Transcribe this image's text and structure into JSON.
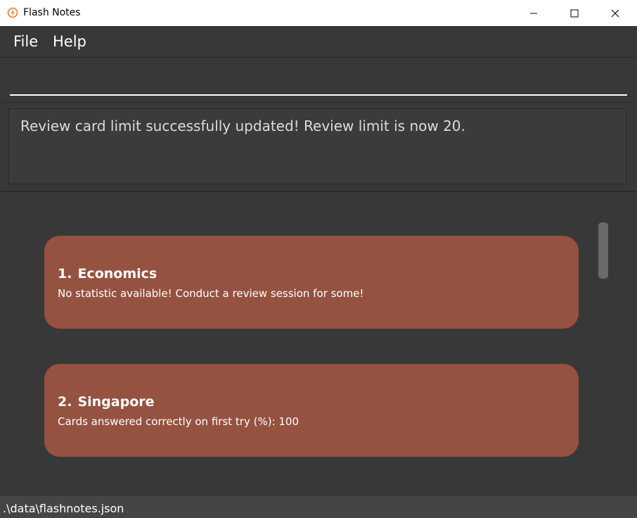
{
  "window": {
    "title": "Flash Notes",
    "icon": "flash-lightning-icon",
    "accent_color": "#f07c1b"
  },
  "menu": {
    "items": [
      {
        "label": "File"
      },
      {
        "label": "Help"
      }
    ]
  },
  "command": {
    "value": "",
    "placeholder": ""
  },
  "result": {
    "message": "Review card limit successfully updated! Review limit is now 20."
  },
  "decks": [
    {
      "index": "1.",
      "name": "Economics",
      "statistic": "No statistic available! Conduct a review session for some!"
    },
    {
      "index": "2.",
      "name": "Singapore",
      "statistic": "Cards answered correctly on first try (%): 100"
    }
  ],
  "colors": {
    "card_background": "#955240",
    "panel_background": "#383838",
    "title_bar": "#ffffff"
  },
  "status": {
    "file_path": ".\\data\\flashnotes.json"
  }
}
